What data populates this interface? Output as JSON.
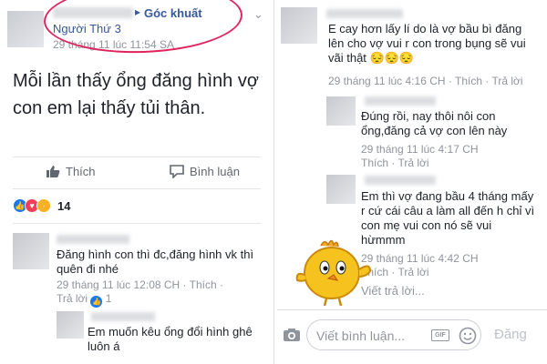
{
  "left": {
    "group_name": "Góc khuất",
    "poster_name": "Người Thứ 3",
    "timestamp": "29 tháng 11 lúc 11:54 SA",
    "post_text": "Mỗi lần thấy ổng đăng hình vợ con em lại thấy tủi thân.",
    "actions": {
      "like": "Thích",
      "comment": "Bình luận"
    },
    "reactions": {
      "count": "14",
      "types": [
        "like-icon",
        "love-icon",
        "sad-icon"
      ]
    },
    "comments": [
      {
        "text": "Đăng hình con thì đc,đăng hình vk thì quên đi nhé",
        "time": "29 tháng 11 lúc 12:08 CH",
        "like": "Thích",
        "reply": "Trả lời",
        "likes": "1"
      },
      {
        "text": "Em muốn kêu ổng đổi hình ghê luôn á"
      }
    ]
  },
  "right": {
    "comments": [
      {
        "text": "E cay hơn lấy lí do là vợ bầu bì đăng lên cho vợ vui r con trong bụng sẽ vui vãi thật 😔😔😔",
        "time": "29 tháng 11 lúc 4:16 CH",
        "like": "Thích",
        "reply": "Trả lời"
      },
      {
        "text": "Đúng rồi, nay thôi nôi con ổng,đăng cả vợ con lên này",
        "time": "29 tháng 11 lúc 4:17 CH",
        "like": "Thích",
        "reply": "Trả lời"
      },
      {
        "text": "Em thì vợ đang bầu 4 tháng mấy r cứ cái câu a làm all đến h chỉ vì con mẹ vui con nó sẽ vui hừmmm",
        "time": "29 tháng 11 lúc 4:42 CH",
        "like": "Thích",
        "reply": "Trả lời"
      }
    ],
    "write_reply": "Viết trả lời...",
    "comment_placeholder": "Viết bình luận...",
    "gif_label": "GIF",
    "post_button": "Đăng"
  },
  "colors": {
    "link": "#365899",
    "meta": "#90949c",
    "highlight_circle": "#e0245e",
    "like_blue": "#1877f2"
  }
}
